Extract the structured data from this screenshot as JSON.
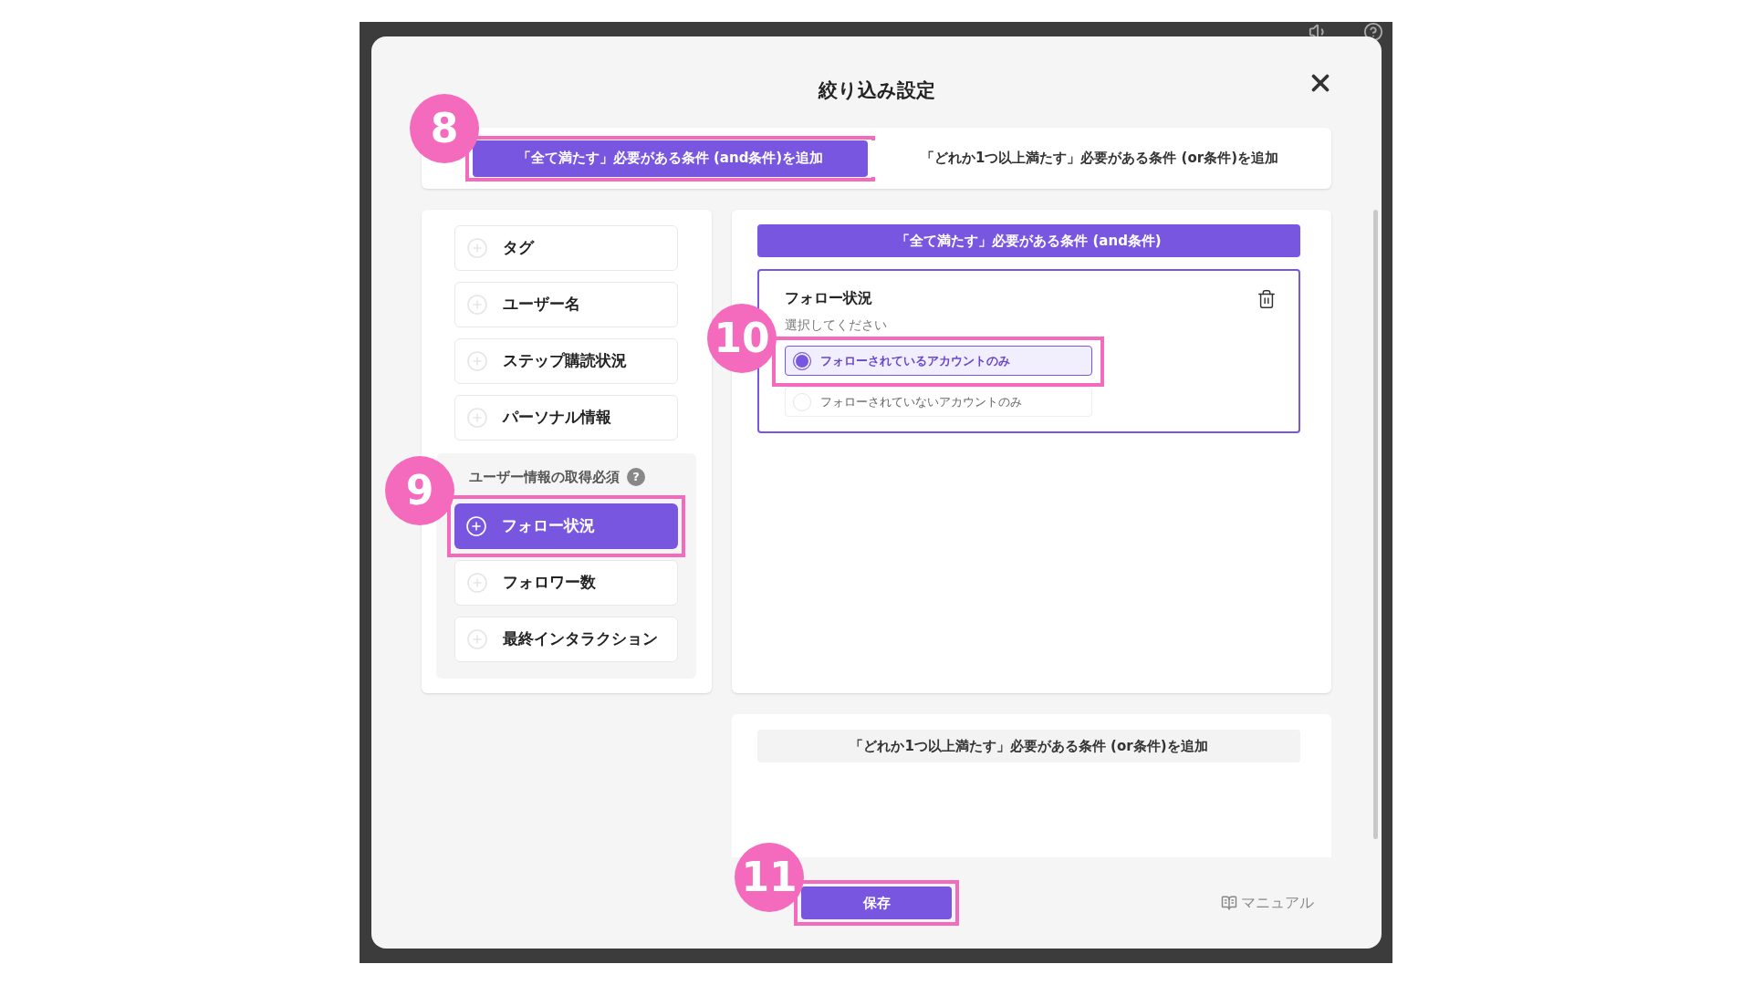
{
  "window": {
    "title": "絞り込み設定"
  },
  "tabs": [
    {
      "label": "「全て満たす」必要がある条件 (and条件)を追加",
      "selected": true,
      "badge": "8"
    },
    {
      "label": "「どれか1つ以上満たす」必要がある条件 (or条件)を追加",
      "selected": false
    }
  ],
  "fields": [
    {
      "label": "タグ",
      "selected": false
    },
    {
      "label": "ユーザー名",
      "selected": false
    },
    {
      "label": "ステップ購読状況",
      "selected": false
    },
    {
      "label": "パーソナル情報",
      "selected": false
    }
  ],
  "required_group": {
    "title": "ユーザー情報の取得必須",
    "help": "?",
    "items": [
      {
        "label": "フォロー状況",
        "selected": true,
        "badge": "9"
      },
      {
        "label": "フォロワー数",
        "selected": false
      },
      {
        "label": "最終インタラクション",
        "selected": false
      }
    ]
  },
  "and_section": {
    "header": "「全て満たす」必要がある条件 (and条件)",
    "condition": {
      "title": "フォロー状況",
      "hint": "選択してください",
      "options": [
        {
          "label": "フォローされているアカウントのみ",
          "selected": true,
          "badge": "10"
        },
        {
          "label": "フォローされていないアカウントのみ",
          "selected": false
        }
      ]
    }
  },
  "or_section": {
    "button": "「どれか1つ以上満たす」必要がある条件 (or条件)を追加"
  },
  "footer": {
    "save": {
      "label": "保存",
      "badge": "11"
    },
    "manual": "マニュアル"
  }
}
